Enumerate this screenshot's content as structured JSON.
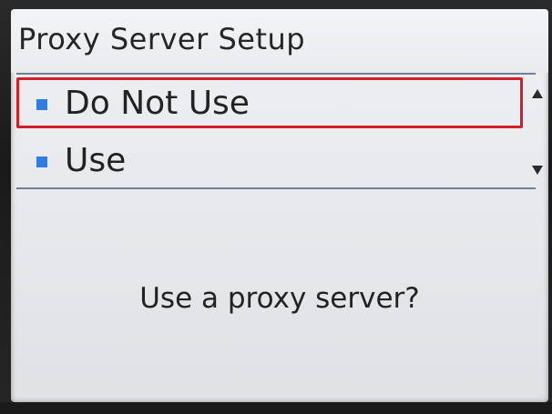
{
  "screen": {
    "title": "Proxy Server Setup",
    "options": [
      {
        "label": "Do Not Use",
        "selected": true
      },
      {
        "label": "Use",
        "selected": false
      }
    ],
    "prompt": "Use a proxy server?"
  },
  "icons": {
    "bullet": "square-bullet-icon",
    "scroll_up": "scroll-up-arrow-icon",
    "scroll_down": "scroll-down-arrow-icon"
  },
  "colors": {
    "selection_border": "#d2202a",
    "bullet": "#2f7de0",
    "divider": "#6f7f98",
    "screen_background": "#e9ebee"
  }
}
